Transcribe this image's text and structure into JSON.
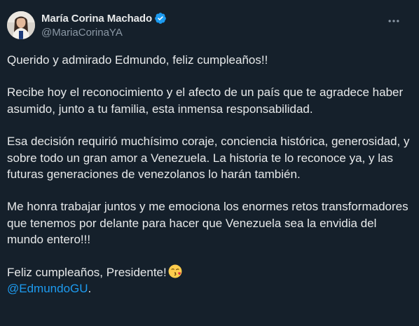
{
  "author": {
    "display_name": "María Corina Machado",
    "handle": "@MariaCorinaYA",
    "verified": true,
    "avatar": "profile-photo"
  },
  "icons": {
    "verified": "verified-badge-icon",
    "more": "more-options-icon",
    "emoji": "face-blowing-kiss-emoji"
  },
  "colors": {
    "background": "#15202b",
    "text": "#e7e9ea",
    "secondary_text": "#8b98a5",
    "accent": "#1d9bf0"
  },
  "tweet": {
    "paragraphs": [
      "Querido y admirado Edmundo, feliz cumpleaños!!",
      "Recibe hoy el reconocimiento y el afecto de un país que te agradece haber asumido, junto a tu familia, esta inmensa responsabilidad.",
      "Esa decisión requirió muchísimo coraje, conciencia histórica, generosidad, y sobre todo un gran amor a Venezuela. La historia te lo reconoce ya, y las futuras generaciones de venezolanos lo harán también.",
      "Me honra trabajar juntos y me emociona los enormes retos transformadores que tenemos por delante para hacer que Venezuela sea la envidia del mundo entero!!!"
    ],
    "closing": "Feliz cumpleaños, Presidente!",
    "mention": "@EdmundoGU",
    "mention_suffix": "."
  }
}
